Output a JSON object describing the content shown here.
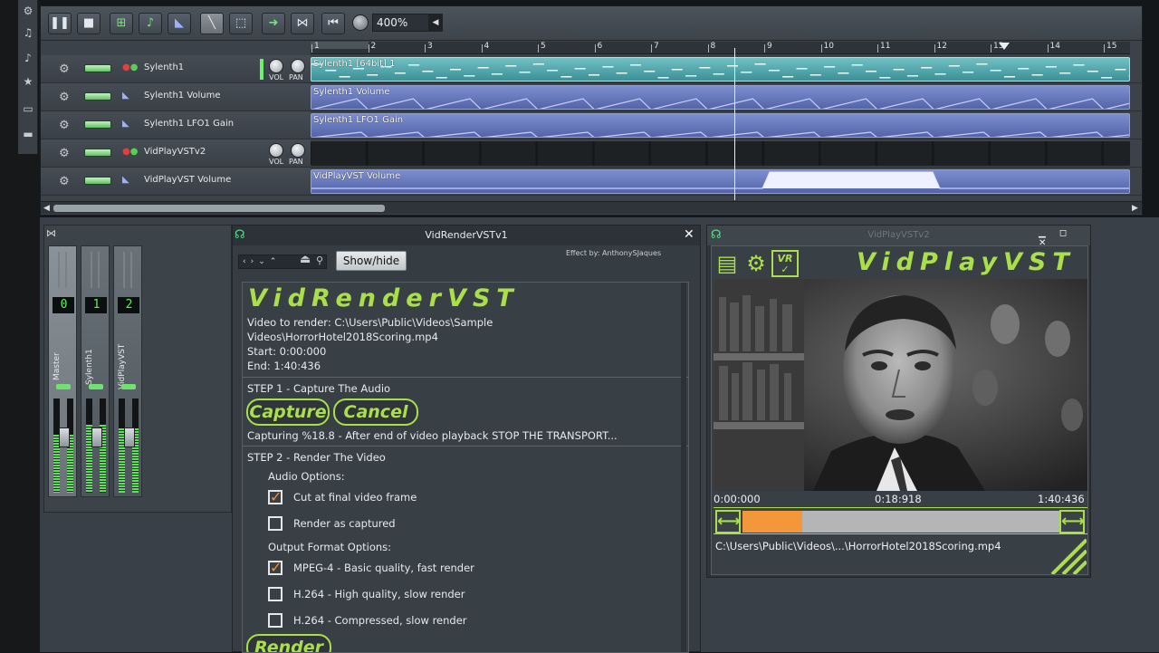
{
  "toolbar": {
    "zoom": "400%",
    "buttons": [
      "pause-icon",
      "stop-icon",
      "add-beat-icon",
      "add-sample-icon",
      "add-automation-icon",
      "draw-icon",
      "select-icon",
      "move-icon",
      "skip-icon",
      "rewind-icon"
    ]
  },
  "ruler": {
    "bars": [
      "1",
      "2",
      "3",
      "4",
      "5",
      "6",
      "7",
      "8",
      "9",
      "10",
      "11",
      "12",
      "13",
      "14",
      "15"
    ]
  },
  "tracks": [
    {
      "name": "Sylenth1",
      "kind": "instrument",
      "pattern": "Sylenth1 [64bit] 1",
      "vol": "VOL",
      "pan": "PAN"
    },
    {
      "name": "Sylenth1 Volume",
      "kind": "automation",
      "pattern": "Sylenth1 Volume"
    },
    {
      "name": "Sylenth1 LFO1 Gain",
      "kind": "automation",
      "pattern": "Sylenth1 LFO1 Gain"
    },
    {
      "name": "VidPlayVSTv2",
      "kind": "instrument",
      "pattern": "",
      "vol": "VOL",
      "pan": "PAN"
    },
    {
      "name": "VidPlayVST Volume",
      "kind": "automation",
      "pattern": "VidPlayVST Volume"
    }
  ],
  "mixer": {
    "channels": [
      {
        "name": "Master",
        "num": "0"
      },
      {
        "name": "Sylenth1",
        "num": "1"
      },
      {
        "name": "VidPlayVST",
        "num": "2"
      }
    ]
  },
  "vidrender": {
    "title": "VidRenderVSTv1",
    "showhide": "Show/hide",
    "effect_by": "Effect by: AnthonySJaques",
    "logo": "VidRenderVST",
    "video_line1": "Video to render: C:\\Users\\Public\\Videos\\Sample",
    "video_line2": "Videos\\HorrorHotel2018Scoring.mp4",
    "start": "Start: 0:00:000",
    "end": "End: 1:40:436",
    "step1": "STEP 1 - Capture The Audio",
    "capture": "Capture",
    "cancel": "Cancel",
    "capturing": "Capturing %18.8 - After end of video playback STOP THE TRANSPORT...",
    "step2": "STEP 2 - Render The Video",
    "audio_options": "Audio Options:",
    "opt_cut": "Cut at final video frame",
    "opt_render_captured": "Render as captured",
    "output_options": "Output Format Options:",
    "opt_mpeg4": "MPEG-4 - Basic quality, fast render",
    "opt_h264_hq": "H.264 - High quality, slow render",
    "opt_h264_comp": "H.264 - Compressed, slow render",
    "render": "Render",
    "checks": {
      "cut": true,
      "render_captured": false,
      "mpeg4": true,
      "h264_hq": false,
      "h264_comp": false
    }
  },
  "vidplay": {
    "title": "VidPlayVSTv2",
    "logo": "VidPlayVST",
    "time_start": "0:00:000",
    "time_current": "0:18:918",
    "time_end": "1:40:436",
    "progress": 0.188,
    "path": "C:\\Users\\Public\\Videos\\...\\HorrorHotel2018Scoring.mp4"
  },
  "colors": {
    "accent": "#a9e04a",
    "progress": "#f4963a",
    "meter": "#5ee05e"
  }
}
